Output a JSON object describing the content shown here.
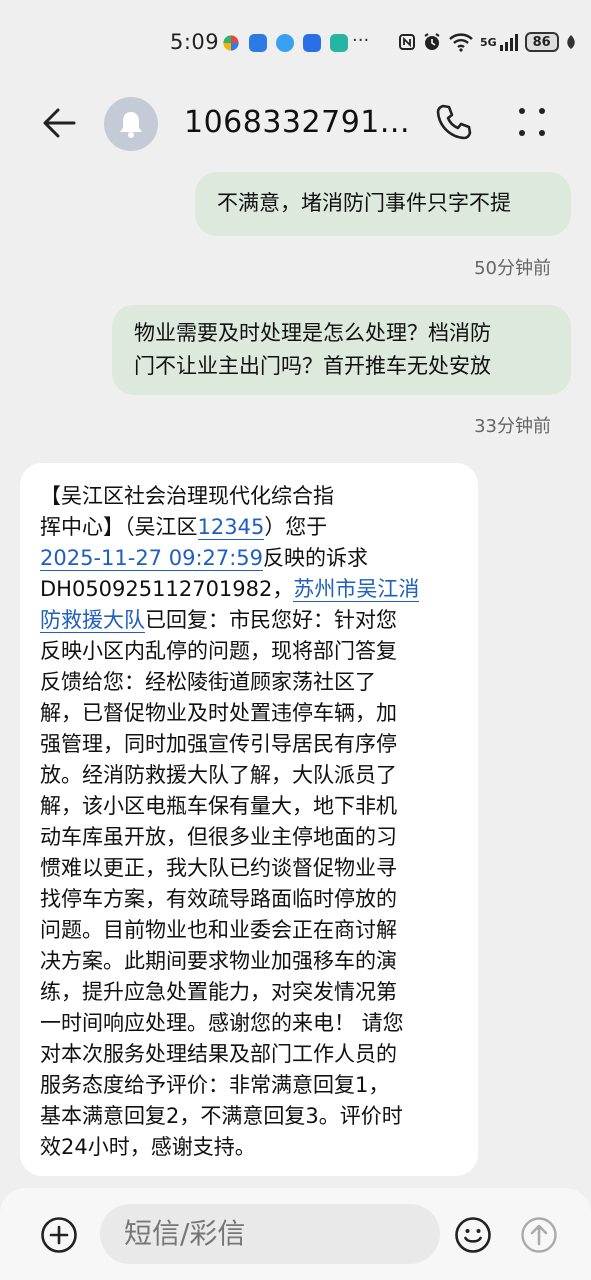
{
  "status_bar": {
    "time": "5:09",
    "more": "···",
    "network": "5G",
    "battery": "86"
  },
  "header": {
    "contact": "1068332791..."
  },
  "messages_out": [
    {
      "text": "不满意，堵消防门事件只字不提",
      "time": "50分钟前"
    },
    {
      "line1": "物业需要及时处理是怎么处理？档消防",
      "line2": "门不让业主出门吗？首开推车无处安放",
      "time": "33分钟前"
    }
  ],
  "message_in": {
    "l1": "【吴江区社会治理现代化综合指",
    "l2a": "挥中心】（吴江区",
    "l2_link": "12345",
    "l2b": "）您于",
    "l3_link": "2025-11-27 09:27:59",
    "l3b": "反映的诉求",
    "l4a": "DH050925112701982，",
    "l4_link": "苏州市吴江消",
    "l5_link": "防救援大队",
    "l5b": "已回复：市民您好：针对您",
    "l6": "反映小区内乱停的问题，现将部门答复",
    "l7": "反馈给您：经松陵街道顾家荡社区了",
    "l8": "解，已督促物业及时处置违停车辆，加",
    "l9": "强管理，同时加强宣传引导居民有序停",
    "l10": "放。经消防救援大队了解，大队派员了",
    "l11": "解，该小区电瓶车保有量大，地下非机",
    "l12": "动车库虽开放，但很多业主停地面的习",
    "l13": "惯难以更正，我大队已约谈督促物业寻",
    "l14": "找停车方案，有效疏导路面临时停放的",
    "l15": "问题。目前物业也和业委会正在商讨解",
    "l16": "决方案。此期间要求物业加强移车的演",
    "l17": "练，提升应急处置能力，对突发情况第",
    "l18": "一时间响应处理。感谢您的来电！ 请您",
    "l19": "对本次服务处理结果及部门工作人员的",
    "l20": "服务态度给予评价：非常满意回复1，",
    "l21": "基本满意回复2，不满意回复3。评价时",
    "l22": "效24小时，感谢支持。"
  },
  "input": {
    "placeholder": "短信/彩信"
  },
  "colors": {
    "outgoing_bubble": "#dde9dd",
    "incoming_bubble": "#ffffff",
    "link": "#1f5fbf",
    "background": "#efefef"
  }
}
